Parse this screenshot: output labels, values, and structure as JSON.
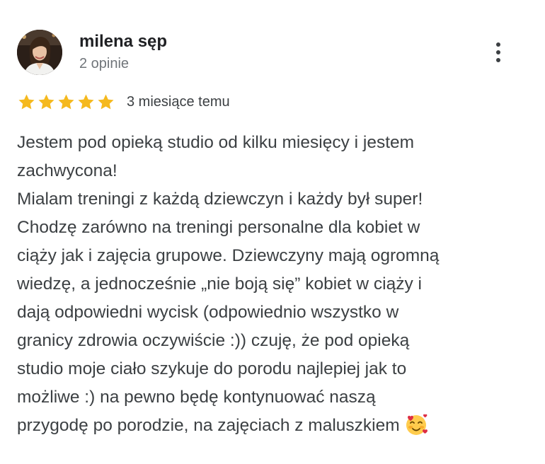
{
  "review": {
    "author_name": "milena sęp",
    "review_count": "2 opinie",
    "rating": 5,
    "rating_max": 5,
    "date": "3 miesiące temu",
    "text_lines": [
      "Jestem pod opieką studio od kilku miesięcy i jestem",
      "zachwycona!",
      "Mialam treningi z każdą dziewczyn i każdy był super!",
      "Chodzę zarówno na treningi personalne dla kobiet w",
      "ciąży jak i zajęcia grupowe. Dziewczyny mają ogromną",
      "wiedzę, a jednocześnie „nie boją się” kobiet w ciąży i",
      "dają odpowiedni wycisk (odpowiednio wszystko w",
      "granicy zdrowia oczywiście :)) czuję, że pod opieką",
      "studio moje ciało szykuje do porodu najlepiej jak to",
      "możliwe :) na pewno będę kontynuować naszą",
      "przygodę po porodzie, na zajęciach z maluszkiem"
    ],
    "trailing_emoji": "smiling-face-with-hearts-icon"
  },
  "icons": {
    "star": "star-icon",
    "more": "more-vert-icon"
  },
  "colors": {
    "star": "#f5b91e",
    "name": "#202124",
    "secondary": "#70757a",
    "body_text": "#3c4043"
  }
}
